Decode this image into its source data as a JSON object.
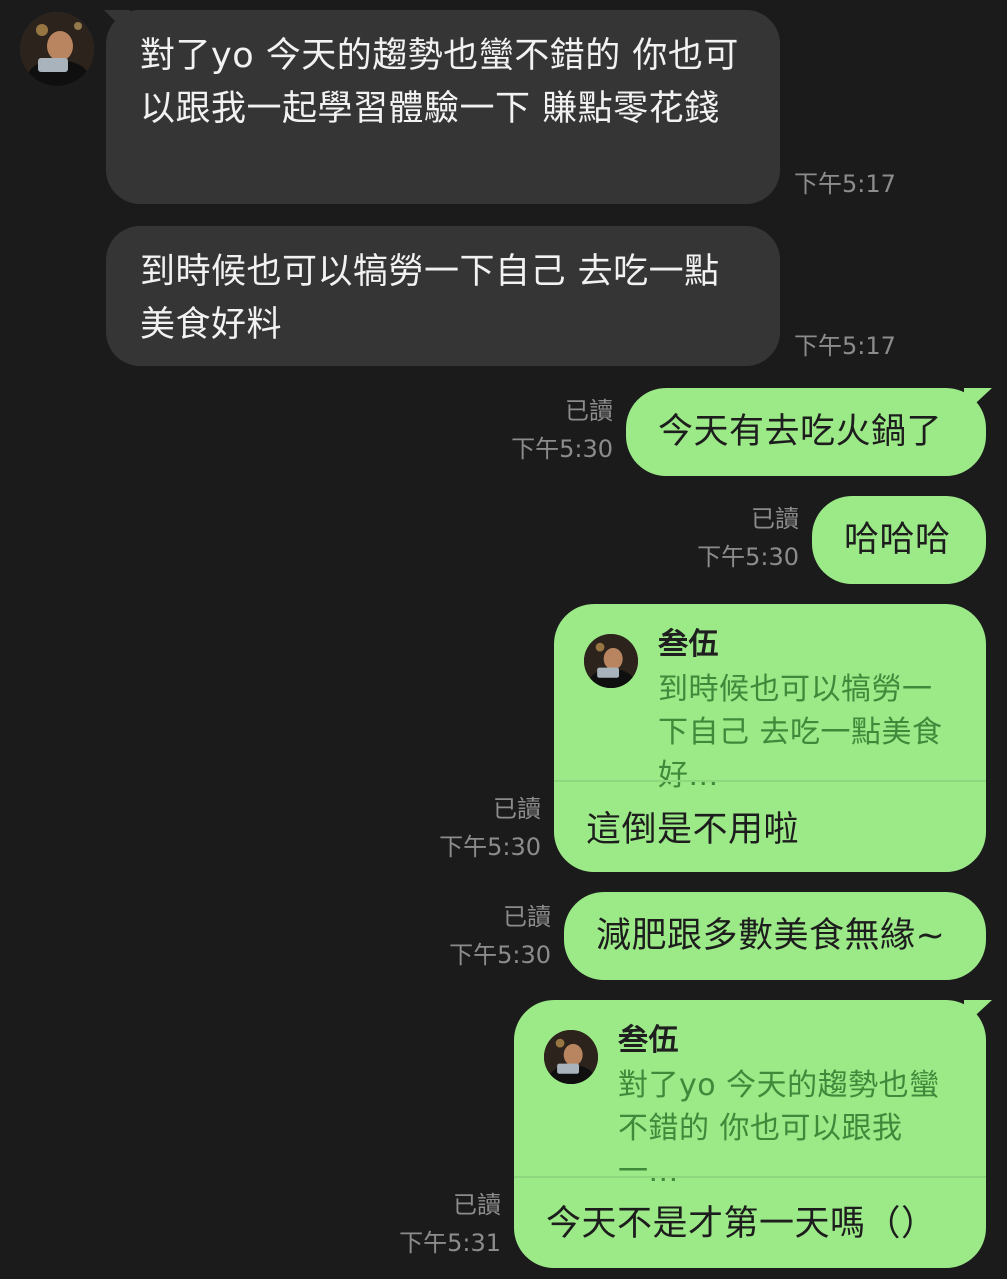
{
  "incoming": [
    {
      "text": "對了yo  今天的趨勢也蠻不錯的 你也可以跟我一起學習體驗一下 賺點零花錢",
      "time": "下午5:17"
    },
    {
      "text": "到時候也可以犒勞一下自己 去吃一點美食好料",
      "time": "下午5:17"
    }
  ],
  "outgoing": [
    {
      "text": "今天有去吃火鍋了",
      "read": "已讀",
      "time": "下午5:30"
    },
    {
      "text": "哈哈哈",
      "read": "已讀",
      "time": "下午5:30"
    },
    {
      "reply_name": "叁伍",
      "reply_snippet": "到時候也可以犒勞一下自己 去吃一點美食好...",
      "text": "這倒是不用啦",
      "read": "已讀",
      "time": "下午5:30"
    },
    {
      "text": "減肥跟多數美食無緣~",
      "read": "已讀",
      "time": "下午5:30"
    },
    {
      "reply_name": "叁伍",
      "reply_snippet": "對了yo  今天的趨勢也蠻不錯的 你也可以跟我一...",
      "text": "今天不是才第一天嗎（）",
      "read": "已讀",
      "time": "下午5:31"
    }
  ],
  "colors": {
    "background": "#1b1b1b",
    "incoming_bubble": "#353535",
    "outgoing_bubble": "#9ce988",
    "meta_text": "#8c8c8c",
    "reply_snippet": "#3f8a3a"
  },
  "icons": {
    "avatar": "user-avatar-photo"
  }
}
